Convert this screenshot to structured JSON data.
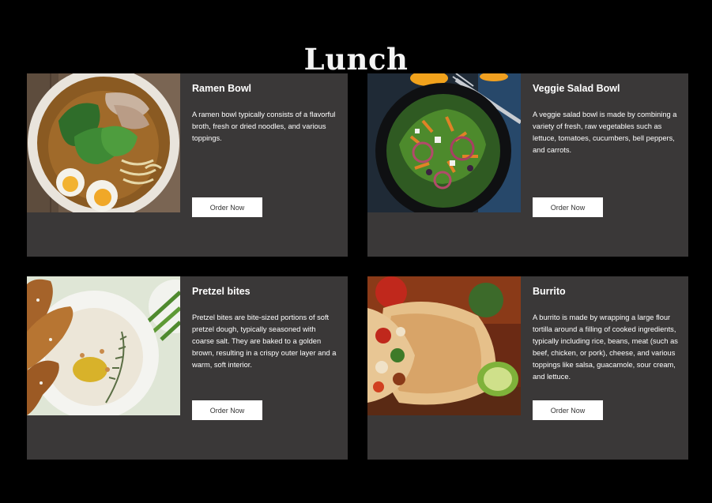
{
  "page": {
    "title": "Lunch"
  },
  "colors": {
    "background": "#000000",
    "card": "#3a3838",
    "button": "#ffffff",
    "button_text": "#333333"
  },
  "menu": [
    {
      "name": "Ramen Bowl",
      "description": "A ramen bowl typically consists of a flavorful broth, fresh or dried noodles, and various toppings.",
      "button": "Order Now",
      "image": "ramen-bowl-photo"
    },
    {
      "name": "Veggie Salad Bowl",
      "description": "A veggie salad bowl is made by combining a variety of fresh, raw vegetables such as lettuce, tomatoes, cucumbers, bell peppers, and carrots.",
      "button": "Order Now",
      "image": "veggie-salad-photo"
    },
    {
      "name": "Pretzel bites",
      "description": "Pretzel bites are bite-sized portions of soft pretzel dough, typically seasoned with coarse salt. They are baked to a golden brown, resulting in a crispy outer layer and a warm, soft interior.",
      "button": "Order Now",
      "image": "pretzel-bites-photo"
    },
    {
      "name": "Burrito",
      "description": "A burrito is made by wrapping a large flour tortilla around a filling of cooked ingredients, typically including rice, beans, meat (such as beef, chicken, or pork), cheese, and various toppings like salsa, guacamole, sour cream, and lettuce.",
      "button": "Order Now",
      "image": "burrito-photo"
    }
  ]
}
